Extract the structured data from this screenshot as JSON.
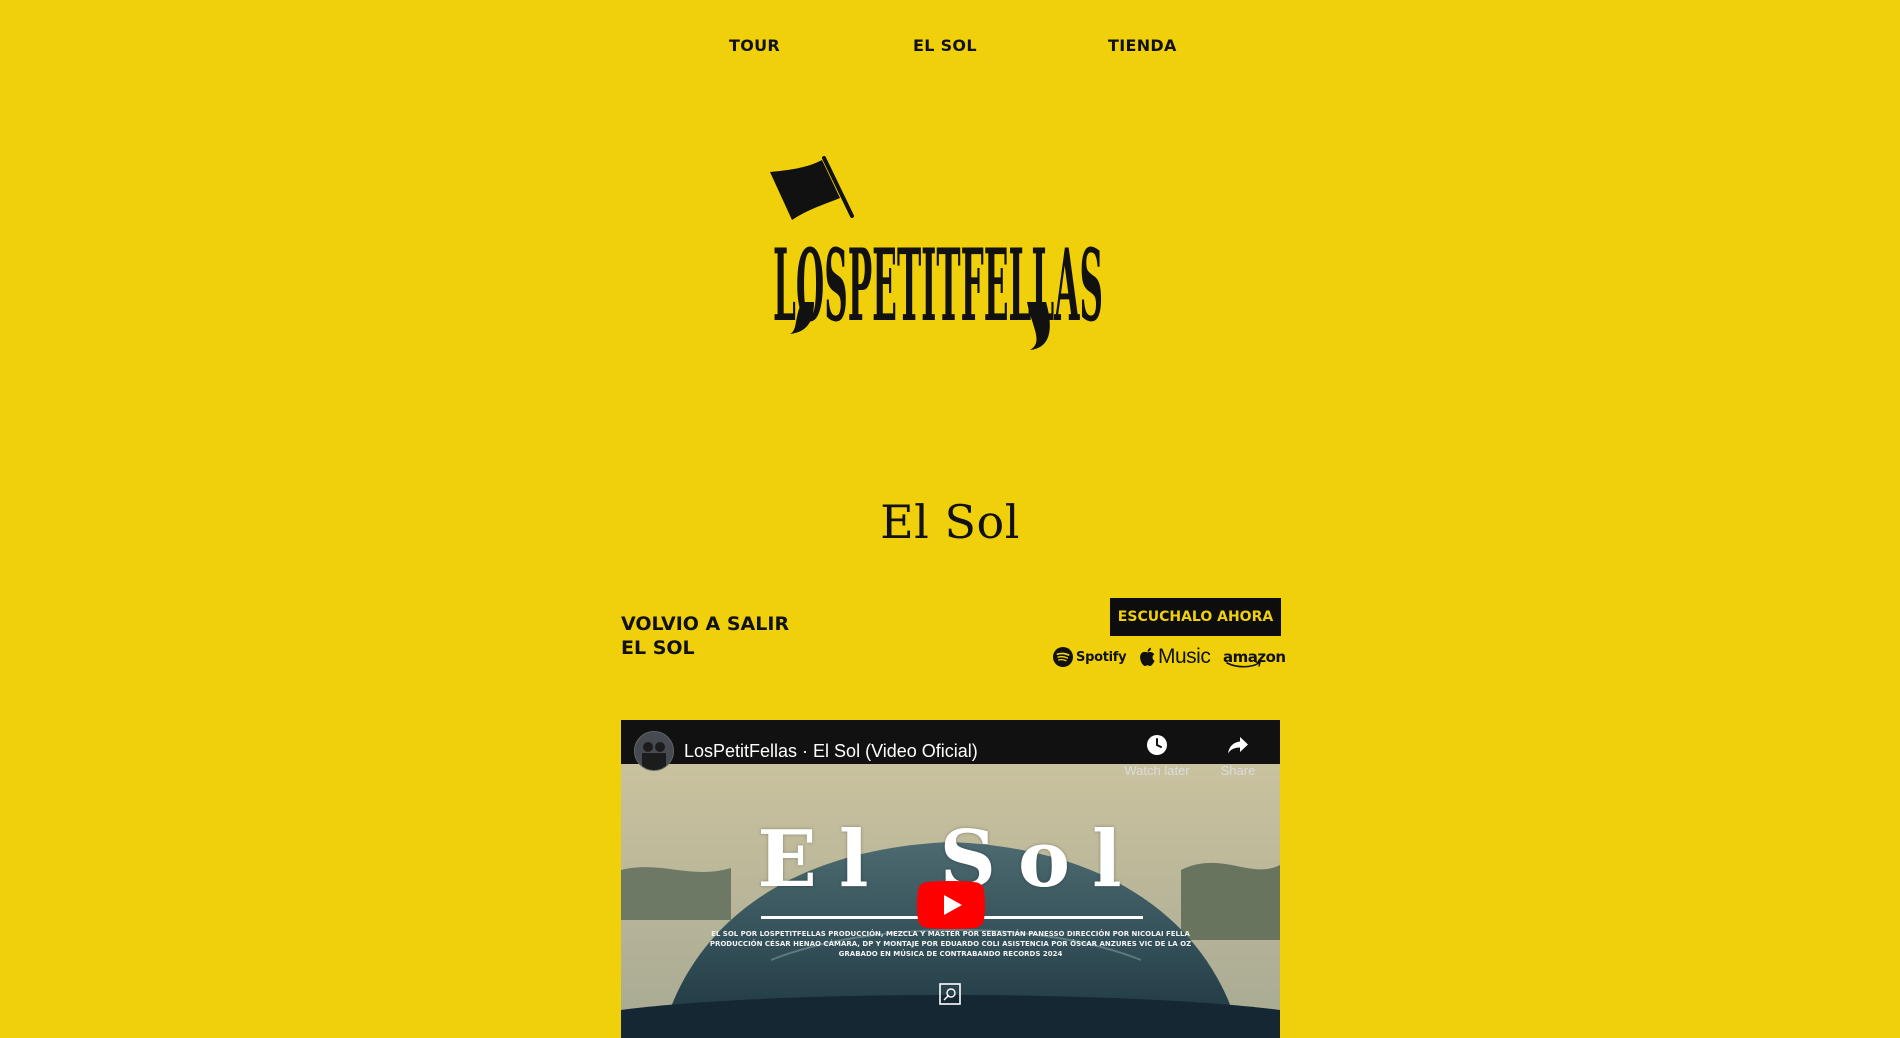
{
  "nav": {
    "items": [
      {
        "label": "TOUR"
      },
      {
        "label": "EL SOL"
      },
      {
        "label": "TIENDA"
      }
    ]
  },
  "logo": {
    "text": "LOSPETITFELLAS",
    "icon": "flag-icon"
  },
  "page": {
    "title": "El Sol"
  },
  "release": {
    "line1": "VOLVIO A SALIR",
    "line2": "EL SOL"
  },
  "listen": {
    "button_label": "ESCUCHALO AHORA"
  },
  "platforms": {
    "spotify": "Spotify",
    "apple": "Music",
    "amazon": "amazon"
  },
  "video": {
    "title": "LosPetitFellas · El Sol (Video Oficial)",
    "watch_later": "Watch later",
    "share": "Share",
    "overlay_title": "El Sol",
    "credits": [
      "EL SOL POR LOSPETITFELLAS PRODUCCIÓN, MEZCLA Y MASTER POR SEBASTIÁN PANESSO DIRECCIÓN POR NICOLAI FELLA",
      "PRODUCCIÓN CÉSAR HENAO CÁMARA, DP Y MONTAJE POR EDUARDO COLI ASISTENCIA POR ÓSCAR ANZURES VIC DE LA OZ",
      "GRABADO EN MÚSICA DE CONTRABANDO RECORDS 2024"
    ]
  },
  "colors": {
    "background": "#efd00b",
    "text": "#111111",
    "button_bg": "#0d0d0d",
    "button_text": "#efd00b",
    "youtube_red": "#ff0000"
  }
}
